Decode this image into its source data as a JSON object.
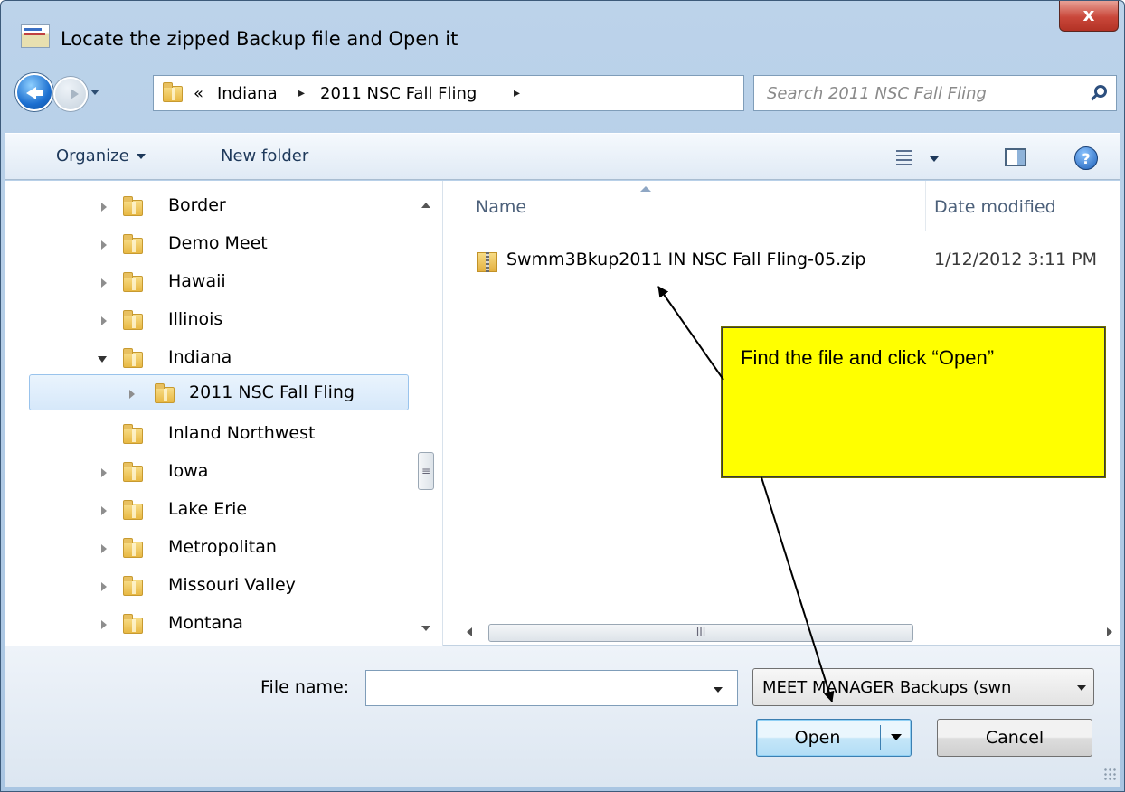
{
  "window": {
    "title": "Locate the zipped Backup file and Open it",
    "close_label": "x"
  },
  "address": {
    "overflow": "«",
    "crumbs": [
      "Indiana",
      "2011 NSC Fall Fling"
    ],
    "separator": "▸",
    "refresh_label": "⇆"
  },
  "search": {
    "placeholder": "Search 2011 NSC Fall Fling"
  },
  "toolbar": {
    "organize_label": "Organize",
    "new_folder_label": "New folder",
    "help_label": "?"
  },
  "nav_tree": [
    {
      "label": "Border",
      "expander": "closed",
      "selected": false
    },
    {
      "label": "Demo Meet",
      "expander": "closed",
      "selected": false
    },
    {
      "label": "Hawaii",
      "expander": "closed",
      "selected": false
    },
    {
      "label": "Illinois",
      "expander": "closed",
      "selected": false
    },
    {
      "label": "Indiana",
      "expander": "open",
      "selected": false
    },
    {
      "label": "2011 NSC Fall Fling",
      "expander": "closed",
      "selected": true
    },
    {
      "label": "Inland Northwest",
      "expander": "none",
      "selected": false
    },
    {
      "label": "Iowa",
      "expander": "closed",
      "selected": false
    },
    {
      "label": "Lake Erie",
      "expander": "closed",
      "selected": false
    },
    {
      "label": "Metropolitan",
      "expander": "closed",
      "selected": false
    },
    {
      "label": "Missouri Valley",
      "expander": "closed",
      "selected": false
    },
    {
      "label": "Montana",
      "expander": "closed",
      "selected": false
    }
  ],
  "scroll": {
    "thumb_grip": "≡",
    "hthumb_grip": "III"
  },
  "files": {
    "columns": {
      "name": "Name",
      "date": "Date modified"
    },
    "rows": [
      {
        "name": "Swmm3Bkup2011 IN NSC Fall Fling-05.zip",
        "date": "1/12/2012 3:11 PM"
      }
    ]
  },
  "bottom": {
    "file_name_label": "File name:",
    "file_name_value": "",
    "filter_value": "MEET MANAGER Backups (swn",
    "open_label": "Open",
    "cancel_label": "Cancel"
  },
  "callout": {
    "text": "Find the file and click “Open”",
    "color": "#ffff00"
  }
}
